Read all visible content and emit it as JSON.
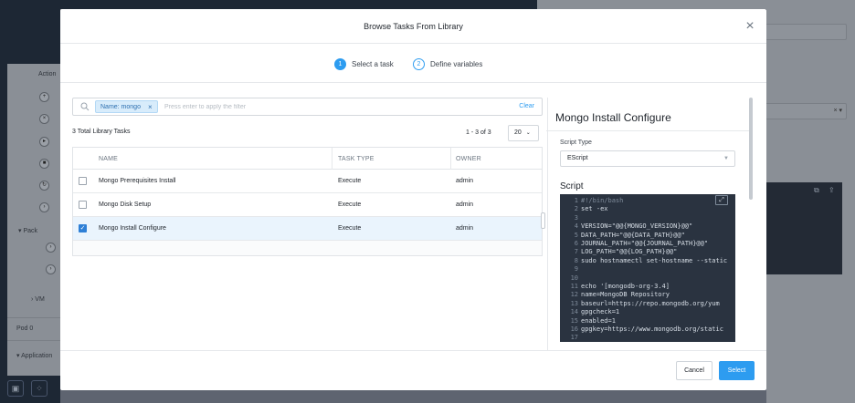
{
  "background": {
    "sidebar_items": [
      "Action",
      "Pack",
      "VM",
      "Pod",
      "Application"
    ],
    "pod_count": "0"
  },
  "modal": {
    "title": "Browse Tasks From Library",
    "close_icon": "close-icon",
    "steps": [
      {
        "number": "1",
        "label": "Select a task",
        "active": true
      },
      {
        "number": "2",
        "label": "Define variables",
        "active": false
      }
    ]
  },
  "filter": {
    "chip_label": "Name: mongo",
    "chip_remove": "×",
    "placeholder": "Press enter to apply the filter",
    "clear_label": "Clear"
  },
  "list": {
    "total_label": "3 Total Library Tasks",
    "range_label": "1 - 3 of 3",
    "page_size": "20",
    "columns": [
      "NAME",
      "TASK TYPE",
      "OWNER"
    ],
    "rows": [
      {
        "name": "Mongo Prerequisites Install",
        "task_type": "Execute",
        "owner": "admin",
        "checked": false
      },
      {
        "name": "Mongo Disk Setup",
        "task_type": "Execute",
        "owner": "admin",
        "checked": false
      },
      {
        "name": "Mongo Install Configure",
        "task_type": "Execute",
        "owner": "admin",
        "checked": true
      }
    ]
  },
  "detail": {
    "title": "Mongo Install Configure",
    "script_type_label": "Script Type",
    "script_type_value": "EScript",
    "script_label": "Script",
    "script_lines": [
      {
        "n": "1",
        "text": "#!/bin/bash",
        "comment": true
      },
      {
        "n": "2",
        "text": "set -ex",
        "comment": false
      },
      {
        "n": "3",
        "text": "",
        "comment": false
      },
      {
        "n": "4",
        "text": "VERSION=\"@@{MONGO_VERSION}@@\"",
        "comment": false
      },
      {
        "n": "5",
        "text": "DATA_PATH=\"@@{DATA_PATH}@@\"",
        "comment": false
      },
      {
        "n": "6",
        "text": "JOURNAL_PATH=\"@@{JOURNAL_PATH}@@\"",
        "comment": false
      },
      {
        "n": "7",
        "text": "LOG_PATH=\"@@{LOG_PATH}@@\"",
        "comment": false
      },
      {
        "n": "8",
        "text": "sudo hostnamectl set-hostname --static",
        "comment": false
      },
      {
        "n": "9",
        "text": "",
        "comment": false
      },
      {
        "n": "10",
        "text": "",
        "comment": false
      },
      {
        "n": "11",
        "text": "echo '[mongodb-org-3.4]",
        "comment": false
      },
      {
        "n": "12",
        "text": "name=MongoDB Repository",
        "comment": false
      },
      {
        "n": "13",
        "text": "baseurl=https://repo.mongodb.org/yum",
        "comment": false
      },
      {
        "n": "14",
        "text": "gpgcheck=1",
        "comment": false
      },
      {
        "n": "15",
        "text": "enabled=1",
        "comment": false
      },
      {
        "n": "16",
        "text": "gpgkey=https://www.mongodb.org/static",
        "comment": false
      },
      {
        "n": "17",
        "text": "",
        "comment": false
      }
    ]
  },
  "footer": {
    "cancel_label": "Cancel",
    "select_label": "Select"
  },
  "colors": {
    "accent": "#2d9cf0",
    "editor_bg": "#2a3340",
    "selected_row": "#eaf4fd"
  }
}
